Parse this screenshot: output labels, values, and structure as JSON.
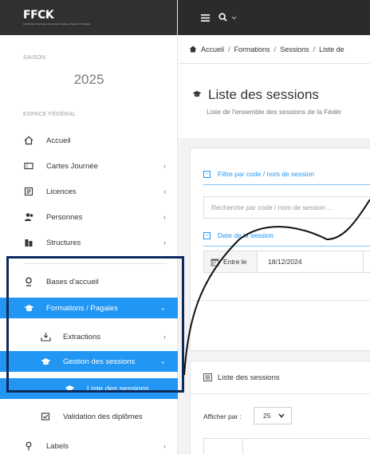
{
  "brand": {
    "name": "FFCK",
    "tagline": "Fédération Française de Canoë-Kayak et Sports de Pagaie"
  },
  "sidebar": {
    "season_label": "SAISON",
    "season_year": "2025",
    "space_label": "ESPACE FÉDÉRAL",
    "items": {
      "accueil": "Accueil",
      "cartes": "Cartes Journée",
      "licences": "Licences",
      "personnes": "Personnes",
      "structures": "Structures",
      "bases": "Bases d'accueil",
      "formations": "Formations / Pagaies",
      "extractions": "Extractions",
      "gestion": "Gestion des sessions",
      "liste": "Liste des sessions",
      "validation": "Validation des diplômes",
      "labels": "Labels"
    }
  },
  "breadcrumb": {
    "home": "Accueil",
    "formations": "Formations",
    "sessions": "Sessions",
    "current": "Liste de"
  },
  "page": {
    "title": "Liste des sessions",
    "subtitle": "Liste de l'ensemble des sessions de la Fédér"
  },
  "filters": {
    "code_heading": "Filtre par code / nom de session",
    "search_placeholder": "Recherche par code / nom de session ...",
    "date_heading": "Date de la session",
    "between_label": "Entre le",
    "date_value": "18/12/2024"
  },
  "list": {
    "heading": "Liste des sessions",
    "per_page_label": "Afficher par :",
    "per_page_value": "25"
  },
  "colors": {
    "accent": "#2196f3",
    "topbar": "#2b2b2b",
    "annotation": "#0d2a5e"
  },
  "icons": {
    "menu": "hamburger-icon",
    "search": "search-icon",
    "home": "home-icon",
    "graduation": "graduation-cap-icon",
    "calendar": "calendar-icon",
    "list": "list-icon"
  }
}
